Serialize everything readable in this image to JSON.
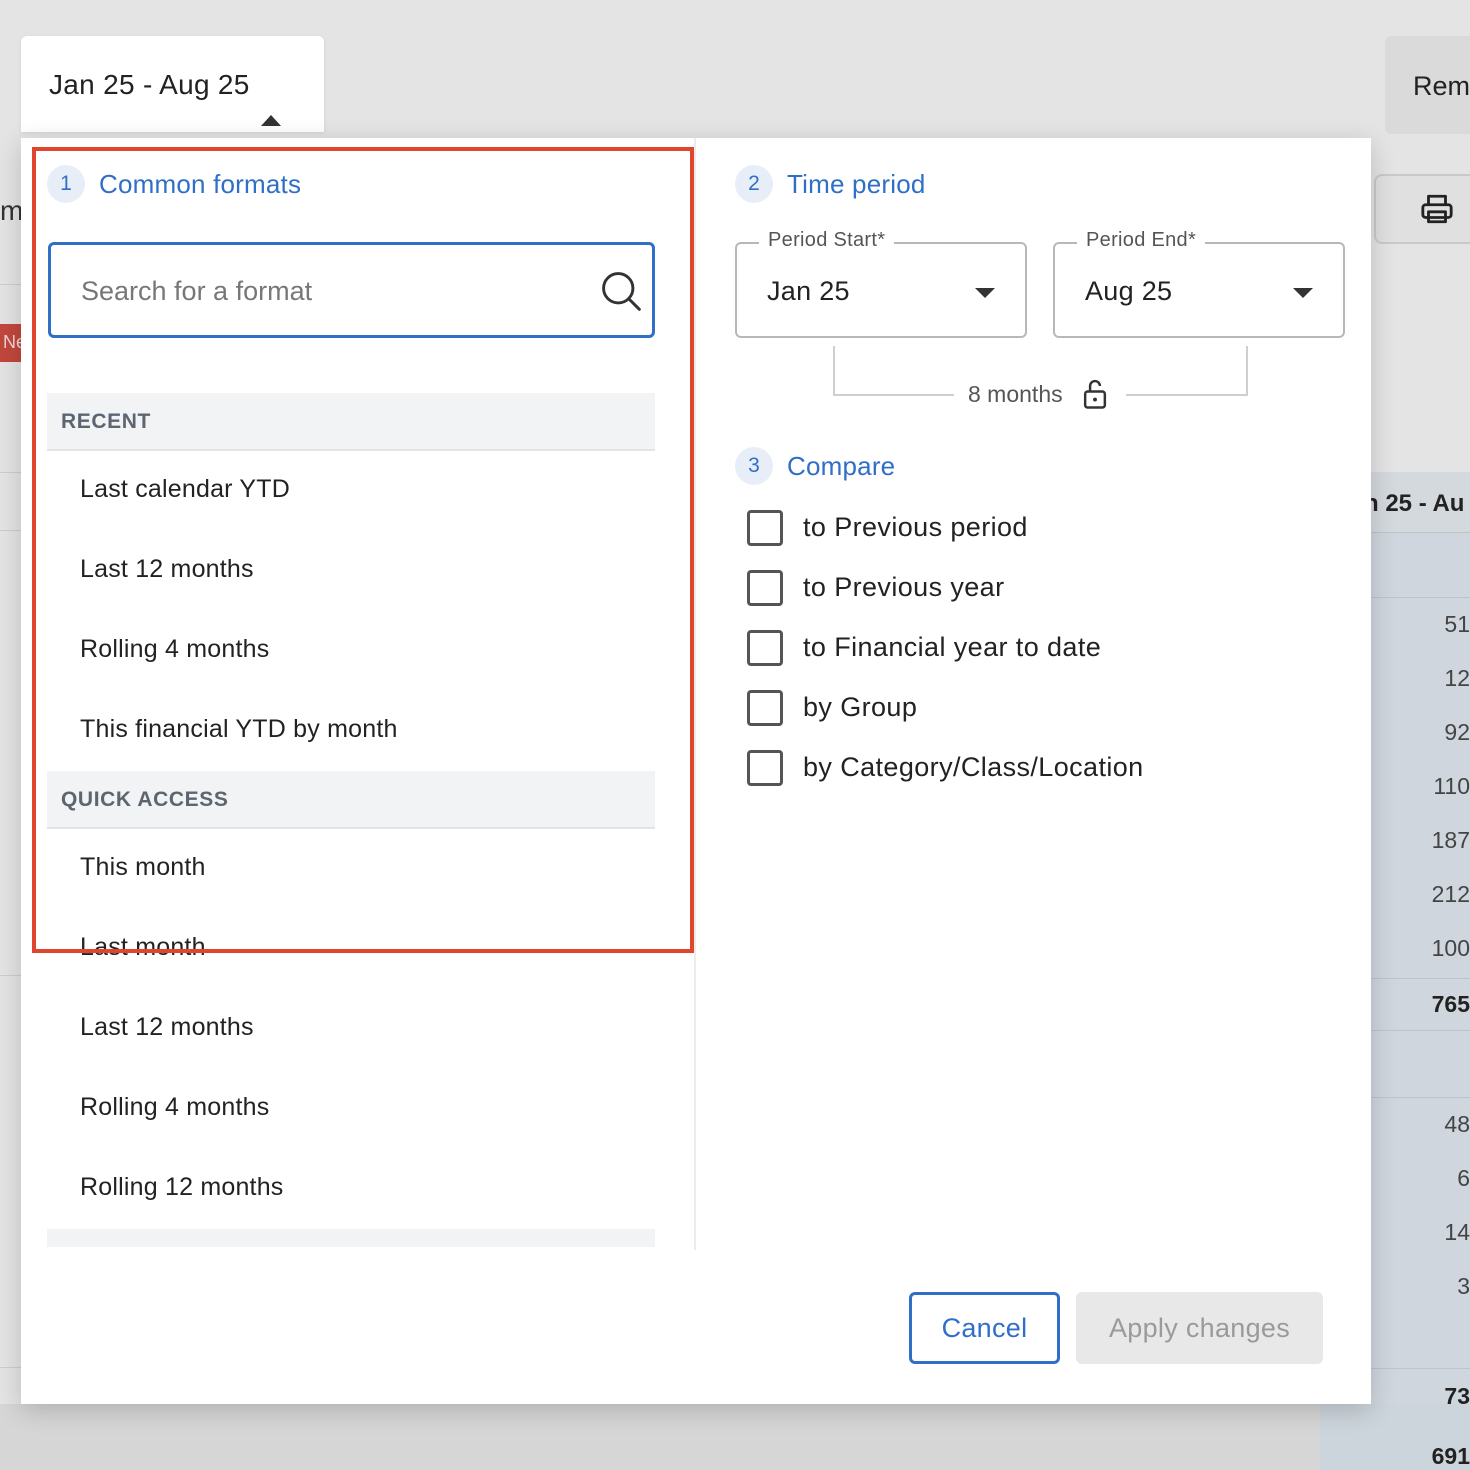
{
  "trigger": {
    "label": "Jan 25 - Aug 25",
    "icon": "caret-up-icon"
  },
  "background": {
    "left_text": "m",
    "tag_text": "Ne",
    "top_button": "Rem",
    "print_icon": "printer-icon",
    "column_header": "n 25 - Au",
    "numbers": [
      "51",
      "12",
      "92",
      "110",
      "187",
      "212",
      "100",
      "765",
      "48",
      "6",
      "14",
      "3",
      "73",
      "691"
    ]
  },
  "formats": {
    "step": "1",
    "title": "Common formats",
    "search_placeholder": "Search for a format",
    "search_icon": "search-icon",
    "sections": [
      {
        "heading": "RECENT",
        "items": [
          "Last calendar YTD",
          "Last 12 months",
          "Rolling 4 months",
          "This financial YTD by month"
        ]
      },
      {
        "heading": "QUICK ACCESS",
        "items": [
          "This month",
          "Last month",
          "Last 12 months",
          "Rolling 4 months",
          "Rolling 12 months"
        ]
      }
    ]
  },
  "period": {
    "step": "2",
    "title": "Time period",
    "start_label": "Period Start*",
    "start_value": "Jan 25",
    "end_label": "Period End*",
    "end_value": "Aug 25",
    "duration": "8 months",
    "duration_icon": "unlock-icon"
  },
  "compare": {
    "step": "3",
    "title": "Compare",
    "options": [
      "to Previous period",
      "to Previous year",
      "to Financial year to date",
      "by Group",
      "by Category/Class/Location"
    ],
    "checked": [
      false,
      false,
      false,
      false,
      false
    ]
  },
  "actions": {
    "cancel": "Cancel",
    "apply": "Apply changes"
  },
  "colors": {
    "accent": "#2f6fc7",
    "highlight": "#e0452e"
  }
}
